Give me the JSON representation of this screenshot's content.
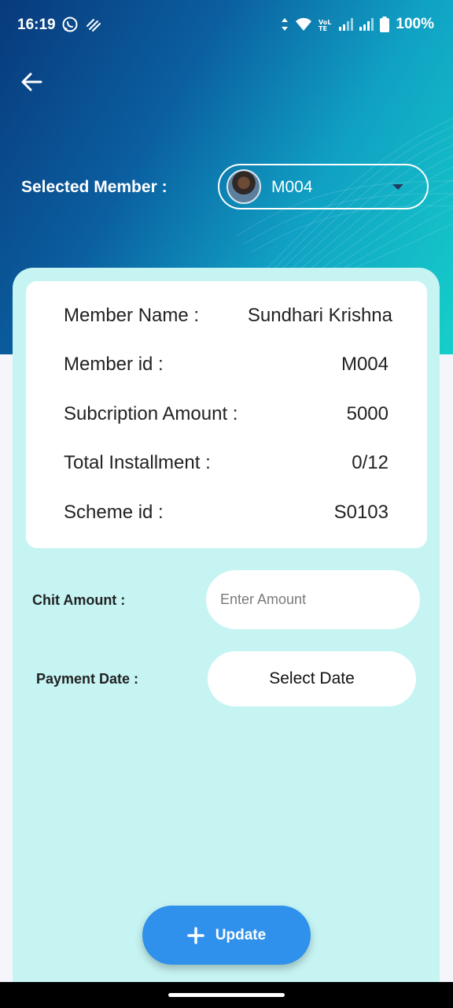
{
  "status_bar": {
    "time": "16:19",
    "battery": "100%",
    "icons_left": [
      "whatsapp-icon",
      "data-saver-icon"
    ],
    "icons_right": [
      "data-arrows-icon",
      "wifi-icon",
      "volte-icon",
      "signal-1-icon",
      "signal-2-icon",
      "battery-icon"
    ]
  },
  "header": {
    "back_icon": "arrow-left-icon",
    "selected_member_label": "Selected Member :",
    "member_dropdown": {
      "value": "M004",
      "avatar": "member-avatar-photo",
      "caret_icon": "caret-down-icon"
    }
  },
  "member_details": {
    "rows": [
      {
        "label": "Member Name :",
        "value": "Sundhari Krishna"
      },
      {
        "label": "Member id :",
        "value": "M004"
      },
      {
        "label": "Subcription Amount :",
        "value": "5000"
      },
      {
        "label": "Total Installment :",
        "value": "0/12"
      },
      {
        "label": "Scheme id :",
        "value": "S0103"
      }
    ]
  },
  "form": {
    "chit_amount_label": "Chit Amount :",
    "chit_amount_placeholder": "Enter Amount",
    "chit_amount_value": "",
    "payment_date_label": "Payment Date :",
    "select_date_label": "Select Date"
  },
  "actions": {
    "update_label": "Update",
    "update_icon": "plus-icon"
  },
  "colors": {
    "header_gradient_start": "#083a7c",
    "header_gradient_end": "#16cfc9",
    "panel_bg": "#c6f4f3",
    "button_blue": "#2f91ec",
    "page_bg": "#f4f6fb"
  }
}
